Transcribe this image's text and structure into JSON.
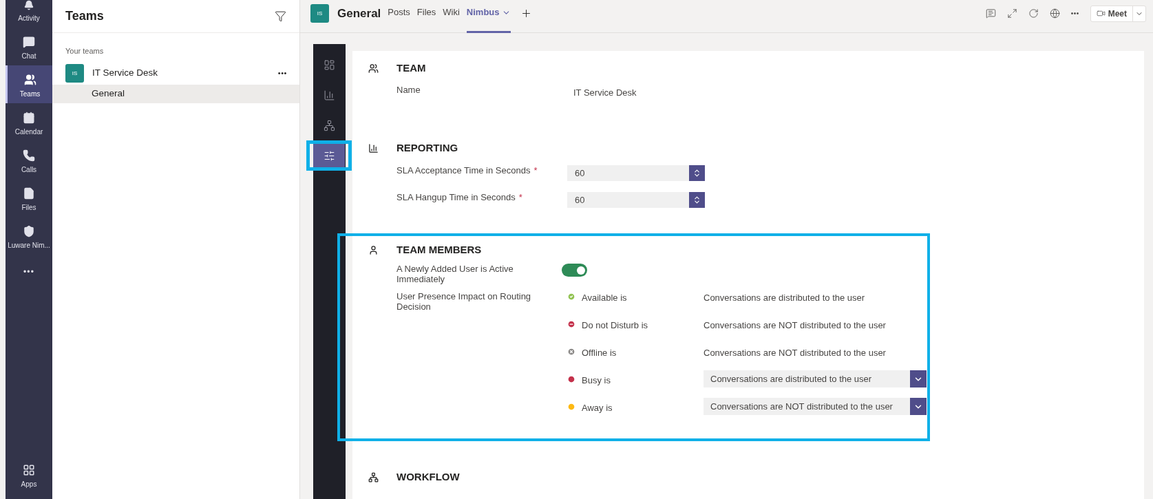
{
  "rail": {
    "items": [
      {
        "label": "Activity",
        "selected": false
      },
      {
        "label": "Chat",
        "selected": false
      },
      {
        "label": "Teams",
        "selected": true
      },
      {
        "label": "Calendar",
        "selected": false
      },
      {
        "label": "Calls",
        "selected": false
      },
      {
        "label": "Files",
        "selected": false
      },
      {
        "label": "Luware Nim...",
        "selected": false
      }
    ],
    "more": "•••",
    "apps": "Apps"
  },
  "teams_panel": {
    "title": "Teams",
    "section_label": "Your teams",
    "team": {
      "initials": "IS",
      "name": "IT Service Desk",
      "more": "•••"
    },
    "channels": [
      {
        "name": "General",
        "selected": true
      }
    ]
  },
  "channel_header": {
    "initials": "IS",
    "title": "General",
    "tabs": [
      {
        "label": "Posts",
        "selected": false
      },
      {
        "label": "Files",
        "selected": false
      },
      {
        "label": "Wiki",
        "selected": false
      },
      {
        "label": "Nimbus",
        "selected": true
      }
    ],
    "more": "•••",
    "meet": "Meet"
  },
  "nimbus_nav": [
    {
      "selected": false,
      "highlighted": false
    },
    {
      "selected": false,
      "highlighted": false
    },
    {
      "selected": false,
      "highlighted": false
    },
    {
      "selected": true,
      "highlighted": true
    }
  ],
  "team": {
    "title": "TEAM",
    "fields": [
      {
        "label": "Name",
        "value": "IT Service Desk"
      }
    ]
  },
  "reporting": {
    "title": "REPORTING",
    "fields": [
      {
        "label": "SLA Acceptance Time in Seconds",
        "required_mark": "*",
        "value": "60"
      },
      {
        "label": "SLA Hangup Time in Seconds",
        "required_mark": "*",
        "value": "60"
      }
    ]
  },
  "team_members": {
    "title": "TEAM MEMBERS",
    "highlighted": true,
    "toggle": {
      "label": "A Newly Added User is Active Immediately",
      "on": true
    },
    "presence": {
      "label": "User Presence Impact on Routing Decision",
      "rows": [
        {
          "status": "Available is",
          "color": "#92c353",
          "kind": "text",
          "value": "Conversations are distributed to the user"
        },
        {
          "status": "Do not Disturb is",
          "color": "#c4314b",
          "kind": "text",
          "value": "Conversations are NOT distributed to the user"
        },
        {
          "status": "Offline is",
          "color": "#8a8886",
          "kind": "text",
          "value": "Conversations are NOT distributed to the user"
        },
        {
          "status": "Busy is",
          "color": "#c4314b",
          "kind": "select",
          "value": "Conversations are distributed to the user"
        },
        {
          "status": "Away is",
          "color": "#fdb913",
          "kind": "select",
          "value": "Conversations are NOT distributed to the user"
        }
      ]
    }
  },
  "workflow": {
    "title": "WORKFLOW"
  }
}
